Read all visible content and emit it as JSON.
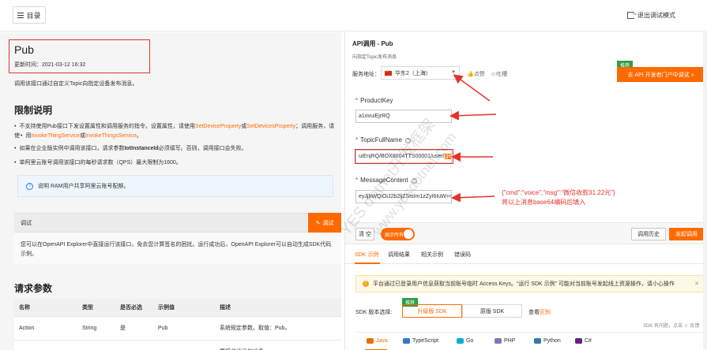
{
  "topbar": {
    "menu_label": "目录",
    "exit_label": "退出调试模式"
  },
  "doc": {
    "title": "Pub",
    "update_time": "更新时间：2021-03-12 16:32",
    "description": "调用该接口通过自定义Topic向指定设备发布消息。",
    "limits_heading": "限制说明",
    "limits": [
      {
        "pre": "不支持使用Pub接口下发设置属性和调用服务的指令。设置属性，请使用",
        "l1": "SetDeviceProperty",
        "mid": "或",
        "l2": "SetDevicesProperty",
        "post": "；调用服务，请使"
      },
      {
        "pre": "用",
        "l1": "InvokeThingService",
        "mid": "或",
        "l2": "InvokeThingsService",
        "post": "。"
      },
      {
        "pre": "如果在企业版实例中调用该接口，请求参数",
        "bold": "IotInstanceId",
        "post": "必须填写。否则，调用接口会失败。"
      },
      {
        "pre": "单阿里云账号调用该接口的每秒请求数（QPS）最大限制为1600。"
      }
    ],
    "note": "说明 RAM用户共享阿里云账号配额。",
    "debug_heading": "调试",
    "debug_button": "调试",
    "debug_text": "您可以在OpenAPI Explorer中直接运行该接口，免去您计算签名的困扰。运行成功后，OpenAPI Explorer可以自动生成SDK代码示例。",
    "params_heading": "请求参数",
    "params_table": {
      "headers": [
        "名称",
        "类型",
        "是否必选",
        "示例值",
        "描述"
      ],
      "rows": [
        [
          "Action",
          "String",
          "是",
          "Pub",
          "系统规定参数。取值：Pub。"
        ],
        [
          "",
          "",
          "",
          "",
          "要接收消息的设备"
        ]
      ]
    }
  },
  "explorer": {
    "title": "API调用 - Pub",
    "subtitle": "向指定Topic发布消息",
    "service_label": "服务地址：",
    "service_value": "华东2（上海）",
    "like": "点赞",
    "dislike": "吐槽",
    "recommend_tag": "推荐",
    "portal_button": "去 API 开发者门户中调试 »",
    "fields": [
      {
        "label": "ProductKey",
        "value": "a1ovuiEjrRQ"
      },
      {
        "label": "TopicFullName",
        "value": "uiEnjRQ/BOX8004TTS00001/user/",
        "highlight": "get"
      },
      {
        "label": "MessageContent",
        "value": "eyJjbWQiOiJ2b2ljZSIsIm1zZyI6IuW+r"
      }
    ],
    "annotation_line1": "{\"cmd\":\"voice\",\"msg\":\"微信收款31.22元\"}",
    "annotation_line2": "将以上消息base64编码后填入",
    "clear": "清 空",
    "show_all": "展示所有",
    "history": "调用历史",
    "invoke": "发起调用",
    "tabs": [
      "SDK 示例",
      "调用结果",
      "相关示例",
      "错误码"
    ],
    "warning": "平台通过已登录用户信息获取当前账号临时 Access Keys。“运行 SDK 示例” 可能对当前账号发起线上资源操作，请小心操作",
    "sdk_label": "SDK 版本选择:",
    "sdk_recommend": "推荐",
    "sdk_new": "升级版 SDK",
    "sdk_old": "原版 SDK",
    "sdk_diff_pre": "查看",
    "sdk_diff_link": "区别",
    "sdk_feedback": "SDK 有问题，点击 ☺ 反馈",
    "languages": [
      "Java",
      "TypeScript",
      "Go",
      "PHP",
      "Python",
      "C#"
    ]
  },
  "watermark": {
    "text1": "YES dotnet开发框架",
    "text2": "www.yesdotnet.com"
  }
}
